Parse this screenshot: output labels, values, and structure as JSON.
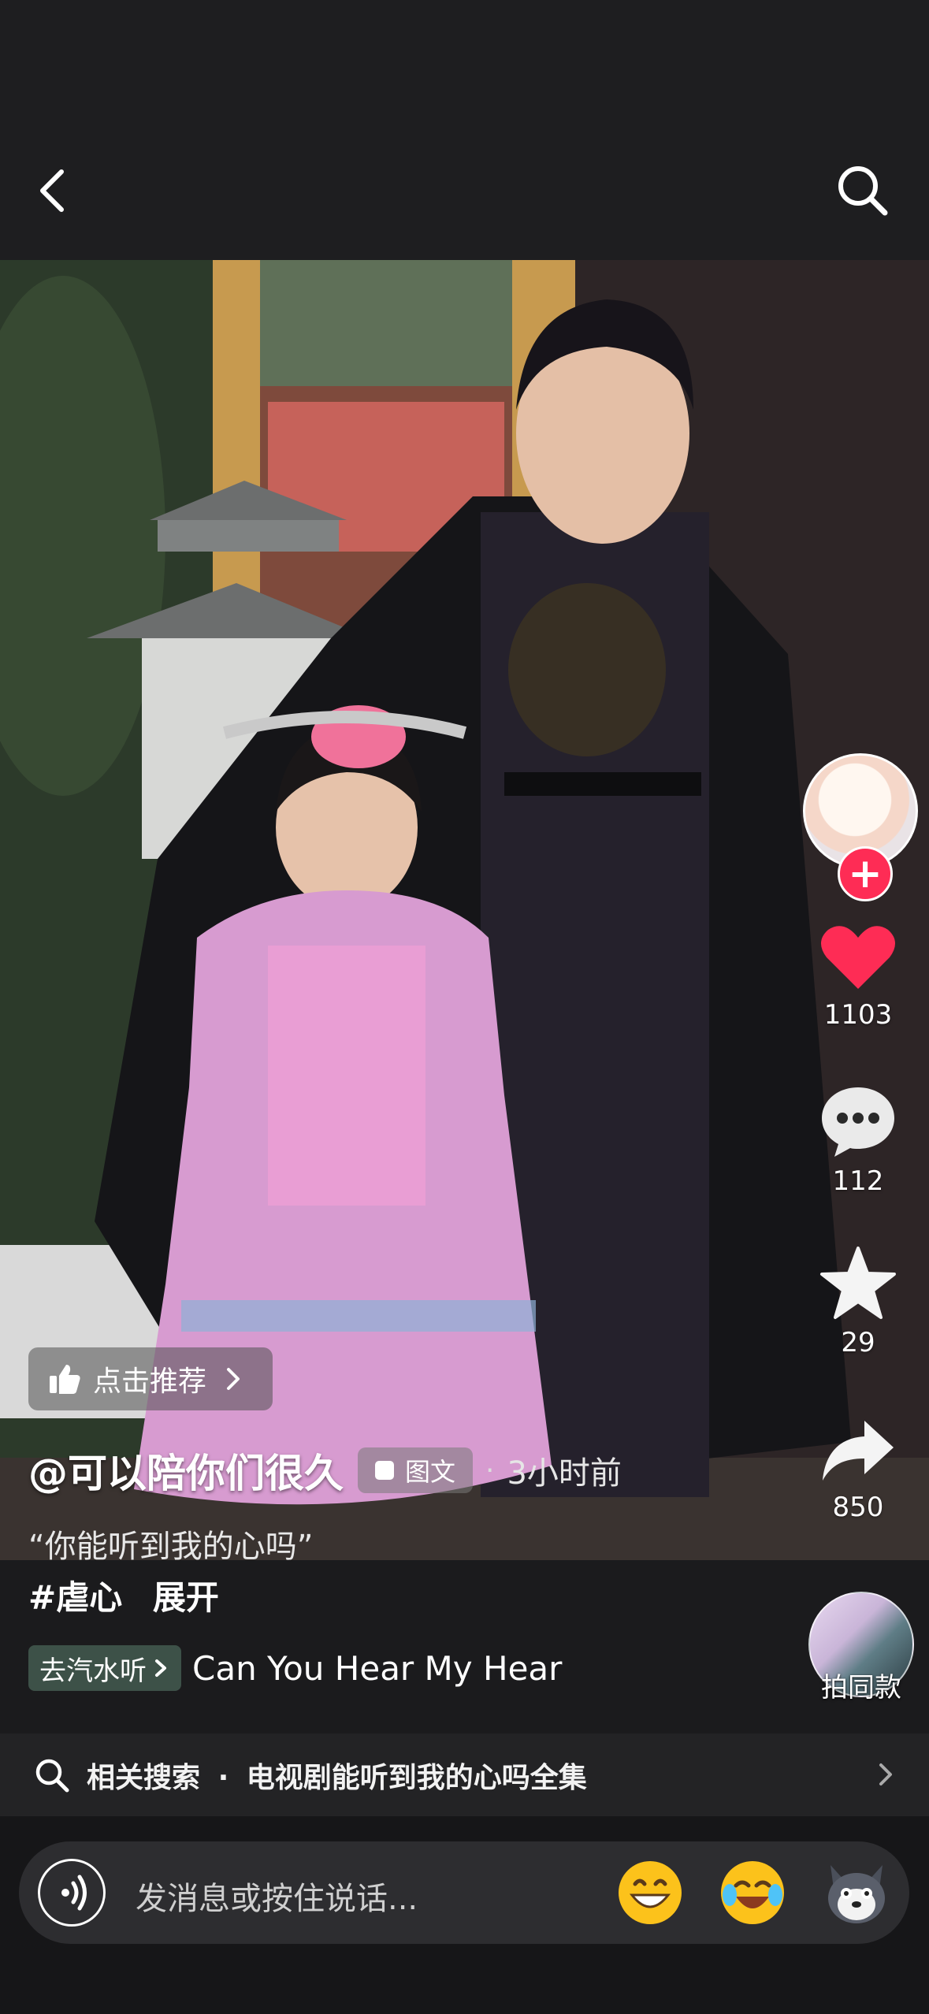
{
  "header": {
    "back_icon": "chevron-left-icon",
    "search_icon": "search-icon"
  },
  "actions": {
    "follow_icon": "plus-icon",
    "likes": "1103",
    "comments": "112",
    "favorites": "29",
    "shares": "850"
  },
  "post": {
    "recommend_label": "点击推荐",
    "author": "@可以陪你们很久",
    "post_type": "图文",
    "separator": "·",
    "time": "3小时前",
    "caption": "“你能听到我的心吗”",
    "hashtag": "#虐心",
    "expand": "展开"
  },
  "music": {
    "button_label": "去汽水听",
    "title": "Can You Hear My Hear"
  },
  "same_style": {
    "label": "拍同款"
  },
  "related_search": {
    "prefix": "相关搜索",
    "dot": "·",
    "query": "电视剧能听到我的心吗全集"
  },
  "input": {
    "placeholder": "发消息或按住说话..."
  },
  "colors": {
    "like": "#fe2c55",
    "background": "#1b1b1d",
    "music_badge": "#3d5148"
  }
}
